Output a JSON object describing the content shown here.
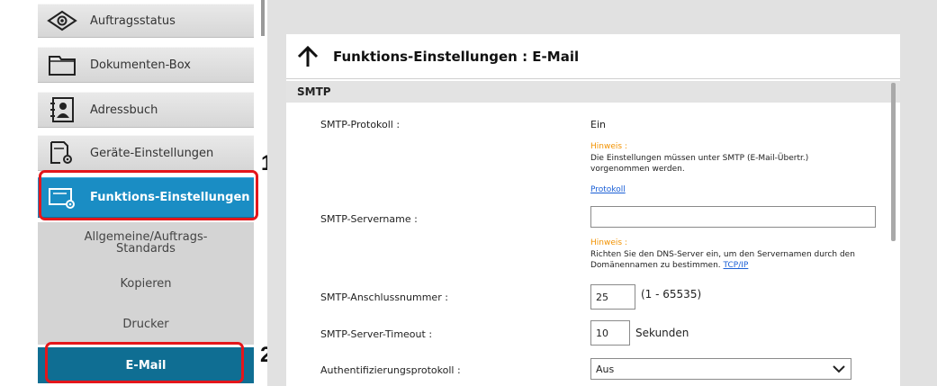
{
  "sidebar": {
    "items": [
      {
        "label": "Auftragsstatus",
        "icon": "eye-icon"
      },
      {
        "label": "Dokumenten-Box",
        "icon": "folder-icon"
      },
      {
        "label": "Adressbuch",
        "icon": "address-book-icon"
      },
      {
        "label": "Geräte-Einstellungen",
        "icon": "device-settings-icon"
      },
      {
        "label": "Funktions-Einstellungen",
        "icon": "function-settings-icon"
      }
    ],
    "subitems": [
      {
        "label": "Allgemeine/Auftrags-Standards"
      },
      {
        "label": "Kopieren"
      },
      {
        "label": "Drucker"
      },
      {
        "label": "E-Mail"
      }
    ]
  },
  "callouts": {
    "one": "1",
    "two": "2"
  },
  "panel": {
    "title": "Funktions-Einstellungen : E-Mail",
    "section": "SMTP",
    "smtp_protocol_label": "SMTP-Protokoll :",
    "smtp_protocol_value": "Ein",
    "hint1_title": "Hinweis :",
    "hint1_text": "Die Einstellungen müssen unter SMTP (E-Mail-Übertr.) vorgenommen werden.",
    "hint1_link": "Protokoll",
    "server_name_label": "SMTP-Servername :",
    "server_name_value": "",
    "hint2_title": "Hinweis :",
    "hint2_text": "Richten Sie den DNS-Server ein, um den Servernamen durch den Domänennamen zu bestimmen.",
    "hint2_link": "TCP/IP",
    "port_label": "SMTP-Anschlussnummer :",
    "port_value": "25",
    "port_range": "(1 - 65535)",
    "timeout_label": "SMTP-Server-Timeout :",
    "timeout_value": "10",
    "timeout_unit": "Sekunden",
    "auth_label": "Authentifizierungsprotokoll :",
    "auth_value": "Aus"
  },
  "colors": {
    "accent": "#1a8dc4",
    "active_sub": "#0f6e93",
    "callout": "#e4161b",
    "hint": "#f29200",
    "link": "#1a5fd6"
  }
}
